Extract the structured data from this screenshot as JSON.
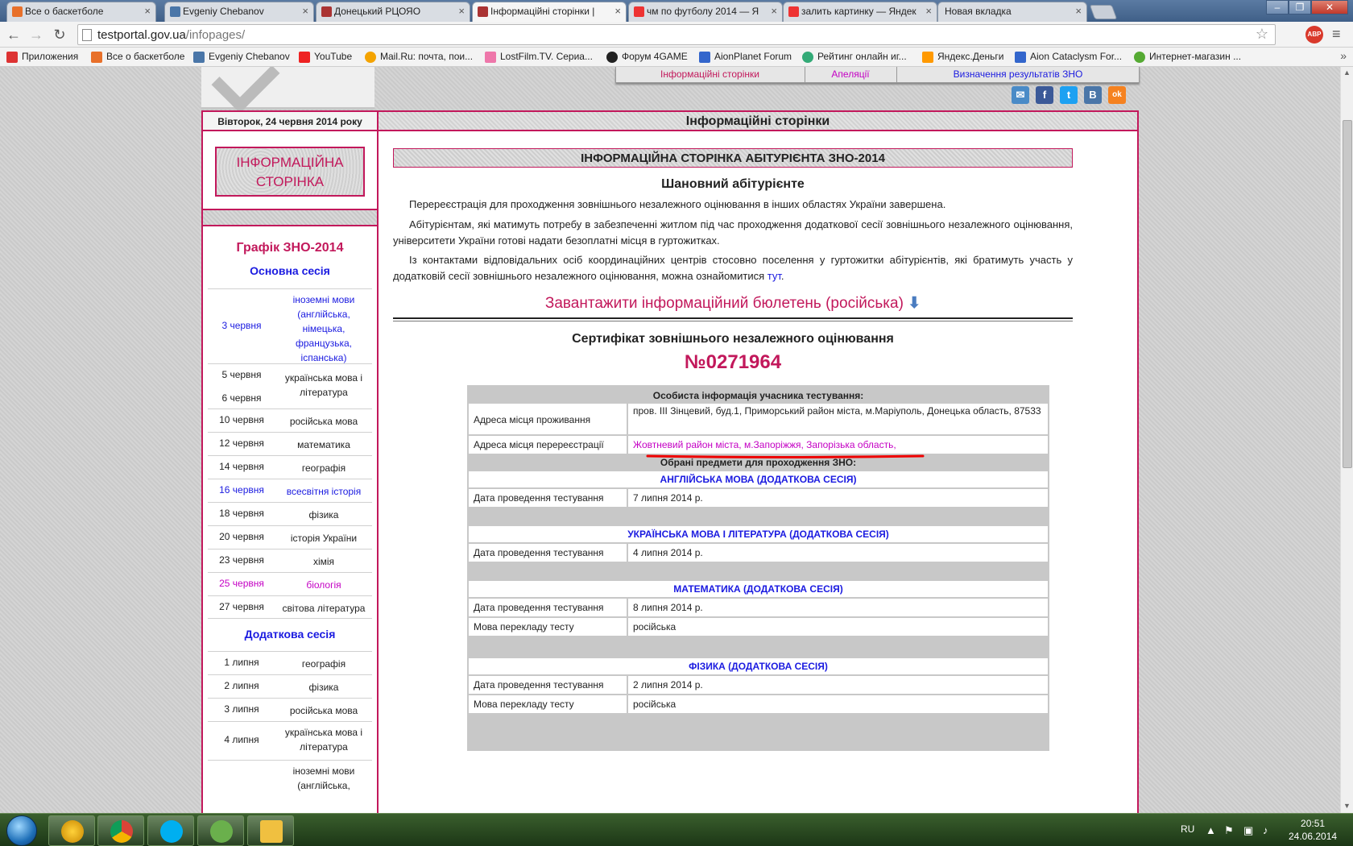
{
  "browser": {
    "tabs": [
      {
        "label": "Все о баскетболе",
        "icon_color": "#e8702a"
      },
      {
        "label": "Evgeniy Chebanov",
        "icon_color": "#4a76a8"
      },
      {
        "label": "Донецький РЦОЯО",
        "icon_color": "#a33"
      },
      {
        "label": "Інформаційні сторінки | ",
        "icon_color": "#a33"
      },
      {
        "label": "чм по футболу 2014 — Я",
        "icon_color": "#e33"
      },
      {
        "label": "залить картинку — Яндек",
        "icon_color": "#e33"
      },
      {
        "label": "Новая вкладка",
        "icon_color": ""
      }
    ],
    "url_host": "testportal.gov.ua",
    "url_path": "/infopages/",
    "abp_label": "ABP",
    "bookmarks": [
      {
        "label": "Приложения",
        "icon_color": "#d33"
      },
      {
        "label": "Все о баскетболе",
        "icon_color": "#e8702a"
      },
      {
        "label": "Evgeniy Chebanov",
        "icon_color": "#4a76a8"
      },
      {
        "label": "YouTube",
        "icon_color": "#e22"
      },
      {
        "label": "Mail.Ru: почта, пои...",
        "icon_color": "#f4a300"
      },
      {
        "label": "LostFilm.TV. Сериа...",
        "icon_color": "#e7a"
      },
      {
        "label": "Форум 4GAME",
        "icon_color": "#222"
      },
      {
        "label": "AionPlanet Forum",
        "icon_color": "#36c"
      },
      {
        "label": "Рейтинг онлайн иг...",
        "icon_color": "#3a7"
      },
      {
        "label": "Яндекс.Деньги",
        "icon_color": "#f90"
      },
      {
        "label": "Aion Cataclysm For...",
        "icon_color": "#36c"
      },
      {
        "label": "Интернет-магазин ...",
        "icon_color": "#5a3"
      }
    ]
  },
  "page": {
    "topnav": [
      {
        "label": "Інформаційні сторінки",
        "color": "#c2185b"
      },
      {
        "label": "Апеляції",
        "color": "#c400c4"
      },
      {
        "label": "Визначення результатів ЗНО",
        "color": "#1a1ae0"
      }
    ],
    "social": [
      "✉",
      "f",
      "t",
      "В",
      "ok"
    ],
    "date": "Вівторок, 24 червня 2014 року",
    "info_box": [
      "ІНФОРМАЦІЙНА",
      "СТОРІНКА"
    ],
    "schedule_title": "Графік ЗНО-2014",
    "main_session_title": "Основна сесія",
    "main_session": [
      {
        "date": "3 червня",
        "subject": "іноземні мови (англійська, німецька, французька, іспанська)",
        "style": "blue"
      },
      {
        "date": "5 червня",
        "subject": "українська мова і література",
        "style": ""
      },
      {
        "date": "6 червня",
        "subject": "",
        "style": ""
      },
      {
        "date": "10 червня",
        "subject": "російська мова",
        "style": ""
      },
      {
        "date": "12 червня",
        "subject": "математика",
        "style": ""
      },
      {
        "date": "14 червня",
        "subject": "географія",
        "style": ""
      },
      {
        "date": "16 червня",
        "subject": "всесвітня історія",
        "style": "blue"
      },
      {
        "date": "18 червня",
        "subject": "фізика",
        "style": ""
      },
      {
        "date": "20 червня",
        "subject": "історія України",
        "style": ""
      },
      {
        "date": "23 червня",
        "subject": "хімія",
        "style": ""
      },
      {
        "date": "25 червня",
        "subject": "біологія",
        "style": "pink"
      },
      {
        "date": "27 червня",
        "subject": "світова література",
        "style": ""
      }
    ],
    "extra_session_title": "Додаткова сесія",
    "extra_session": [
      {
        "date": "1 липня",
        "subject": "географія"
      },
      {
        "date": "2 липня",
        "subject": "фізика"
      },
      {
        "date": "3 липня",
        "subject": "російська мова"
      },
      {
        "date": "4 липня",
        "subject": "українська мова і література"
      },
      {
        "date": "",
        "subject": "іноземні мови (англійська,"
      }
    ],
    "main_header": "Інформаційні сторінки",
    "banner": "ІНФОРМАЦІЙНА СТОРІНКА АБІТУРІЄНТА ЗНО-2014",
    "greeting": "Шановний абітурієнте",
    "para1": "Перереєстрація для проходження зовнішнього незалежного оцінювання в інших областях України завершена.",
    "para2": "Абітурієнтам, які матимуть потребу в забезпеченні житлом під час проходження додаткової сесії зовнішнього незалежного оцінювання, університети України готові надати безоплатні місця в гуртожитках.",
    "para3": "Із контактами відповідальних осіб координаційних центрів стосовно поселення у гуртожитки абітурієнтів, які братимуть участь у додатковій сесії зовнішнього незалежного оцінювання, можна ознайомитися ",
    "para3_link": "тут",
    "para3_end": ".",
    "download": "Завантажити інформаційний бюлетень (російська)",
    "cert_title": "Сертифікат зовнішнього незалежного оцінювання",
    "cert_number": "№0271964",
    "personal_header": "Особиста інформація учасника тестування:",
    "addr_label": "Адреса місця проживання",
    "addr_value": "пров. III Зінцевий, буд.1, Приморський район міста, м.Маріуполь, Донецька область, 87533",
    "rereg_label": "Адреса місця перереєстрації",
    "rereg_value": "Жовтневий район міста, м.Запоріжжя, Запорізька область,",
    "subjects_header": "Обрані предмети для проходження ЗНО:",
    "date_label": "Дата проведення тестування",
    "lang_label": "Мова перекладу тесту",
    "subjects": [
      {
        "name": "АНГЛІЙСЬКА МОВА (ДОДАТКОВА СЕСІЯ)",
        "date": "7 липня 2014 р.",
        "lang": ""
      },
      {
        "name": "УКРАЇНСЬКА МОВА І ЛІТЕРАТУРА (ДОДАТКОВА СЕСІЯ)",
        "date": "4 липня 2014 р.",
        "lang": ""
      },
      {
        "name": "МАТЕМАТИКА (ДОДАТКОВА СЕСІЯ)",
        "date": "8 липня 2014 р.",
        "lang": "російська"
      },
      {
        "name": "ФІЗИКА (ДОДАТКОВА СЕСІЯ)",
        "date": "2 липня 2014 р.",
        "lang": "російська"
      }
    ]
  },
  "taskbar": {
    "lang": "RU",
    "time": "20:51",
    "date": "24.06.2014"
  }
}
